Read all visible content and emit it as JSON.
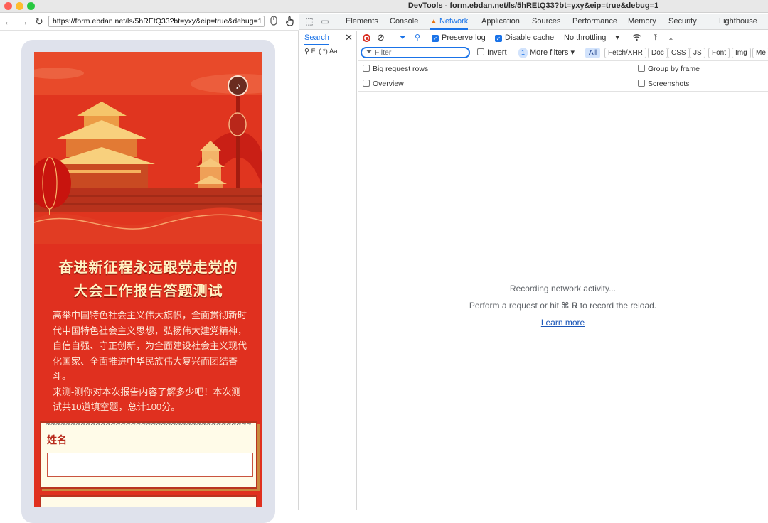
{
  "window": {
    "title": "DevTools - form.ebdan.net/ls/5hREtQ33?bt=yxy&eip=true&debug=1"
  },
  "browser": {
    "url": "https://form.ebdan.net/ls/5hREtQ33?bt=yxy&eip=true&debug=1"
  },
  "page": {
    "heading_line1": "奋进新征程永远跟党走党的",
    "heading_line2": "大会工作报告答题测试",
    "intro_paragraph1": "高举中国特色社会主义伟大旗帜，全面贯彻新时代中国特色社会主义思想，弘扬伟大建党精神，自信自强、守正创新，为全面建设社会主义现代化国家、全面推进中华民族伟大复兴而团结奋斗。",
    "intro_paragraph2": "来测-测你对本次报告内容了解多少吧！本次测试共10道填空题，总计100分。",
    "name_field_label": "姓名",
    "name_field_value": ""
  },
  "devtools": {
    "tabs": [
      "Elements",
      "Console",
      "Network",
      "Application",
      "Sources",
      "Performance",
      "Memory",
      "Security",
      "Lighthouse"
    ],
    "active_tab": "Network",
    "search_panel_title": "Search",
    "search_options": "Fi  (.*)  Aa",
    "preserve_log_label": "Preserve log",
    "preserve_log_checked": true,
    "disable_cache_label": "Disable cache",
    "disable_cache_checked": true,
    "throttling": "No throttling",
    "filter_placeholder": "Filter",
    "invert_label": "Invert",
    "more_filters_count": "1",
    "more_filters_label": "More filters",
    "type_filters": [
      "All",
      "Fetch/XHR",
      "Doc",
      "CSS",
      "JS",
      "Font",
      "Img",
      "Me"
    ],
    "active_type_filter": "All",
    "options": {
      "big_request_rows": "Big request rows",
      "group_by_frame": "Group by frame",
      "overview": "Overview",
      "screenshots": "Screenshots"
    },
    "empty_state": {
      "line1": "Recording network activity...",
      "line2_prefix": "Perform a request or hit",
      "line2_shortcut": "⌘ R",
      "line2_suffix": "to record the reload.",
      "link": "Learn more"
    }
  },
  "colors": {
    "accent": "#1a73e8",
    "page_red": "#e0301f",
    "heading_gold": "#fff3c4"
  }
}
